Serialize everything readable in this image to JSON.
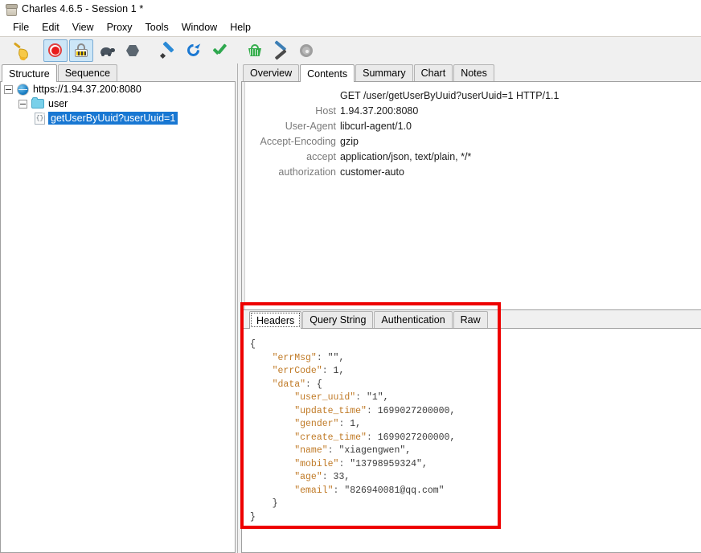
{
  "window": {
    "title": "Charles 4.6.5 - Session 1 *",
    "app_icon": "charles-jar-icon"
  },
  "menubar": {
    "items": [
      "File",
      "Edit",
      "View",
      "Proxy",
      "Tools",
      "Window",
      "Help"
    ]
  },
  "toolbar": {
    "buttons": [
      {
        "name": "clear-session-icon",
        "label": "Clear Session",
        "selected": false
      },
      {
        "name": "record-icon",
        "label": "Start Recording",
        "selected": true
      },
      {
        "name": "ssl-proxying-icon",
        "label": "SSL Proxying",
        "selected": true
      },
      {
        "name": "throttle-icon",
        "label": "Throttling",
        "selected": false
      },
      {
        "name": "stop-icon",
        "label": "Breakpoints",
        "selected": false
      },
      {
        "name": "compose-icon",
        "label": "Compose",
        "selected": false
      },
      {
        "name": "repeat-icon",
        "label": "Repeat",
        "selected": false
      },
      {
        "name": "validate-icon",
        "label": "Validate",
        "selected": false
      },
      {
        "name": "tools-basket-icon",
        "label": "Tools",
        "selected": false
      },
      {
        "name": "settings-tools-icon",
        "label": "Settings",
        "selected": false
      },
      {
        "name": "gear-icon",
        "label": "Preferences",
        "selected": false
      }
    ]
  },
  "left_pane": {
    "tabs": [
      {
        "label": "Structure",
        "active": true
      },
      {
        "label": "Sequence",
        "active": false
      }
    ],
    "tree": {
      "host": "https://1.94.37.200:8080",
      "folder": "user",
      "leaf": "getUserByUuid?userUuid=1",
      "leaf_selected": true,
      "selection_color": "#1877d2"
    }
  },
  "right_pane": {
    "tabs": [
      {
        "label": "Overview",
        "active": false
      },
      {
        "label": "Contents",
        "active": true
      },
      {
        "label": "Summary",
        "active": false
      },
      {
        "label": "Chart",
        "active": false
      },
      {
        "label": "Notes",
        "active": false
      }
    ],
    "request_line": "GET /user/getUserByUuid?userUuid=1 HTTP/1.1",
    "headers": [
      {
        "name": "Host",
        "value": "1.94.37.200:8080"
      },
      {
        "name": "User-Agent",
        "value": "libcurl-agent/1.0"
      },
      {
        "name": "Accept-Encoding",
        "value": "gzip"
      },
      {
        "name": "accept",
        "value": "application/json, text/plain, */*"
      },
      {
        "name": "authorization",
        "value": "customer-auto"
      }
    ]
  },
  "bottom_pane": {
    "tabs": [
      {
        "label": "Headers",
        "active": true
      },
      {
        "label": "Query String",
        "active": false
      },
      {
        "label": "Authentication",
        "active": false
      },
      {
        "label": "Raw",
        "active": false
      }
    ],
    "response_json": "{\n    \"errMsg\": \"\",\n    \"errCode\": 1,\n    \"data\": {\n        \"user_uuid\": \"1\",\n        \"update_time\": 1699027200000,\n        \"gender\": 1,\n        \"create_time\": 1699027200000,\n        \"name\": \"xiagengwen\",\n        \"mobile\": \"13798959324\",\n        \"age\": 33,\n        \"email\": \"826940081@qq.com\"\n    }\n}",
    "json_fields": {
      "errMsg": "",
      "errCode": 1,
      "data": {
        "user_uuid": "1",
        "update_time": 1699027200000,
        "gender": 1,
        "create_time": 1699027200000,
        "name": "xiagengwen",
        "mobile": "13798959324",
        "age": 33,
        "email": "826940081@qq.com"
      }
    }
  },
  "annotation": {
    "highlight_color": "#ee0000",
    "name": "red-highlight-rectangle"
  }
}
